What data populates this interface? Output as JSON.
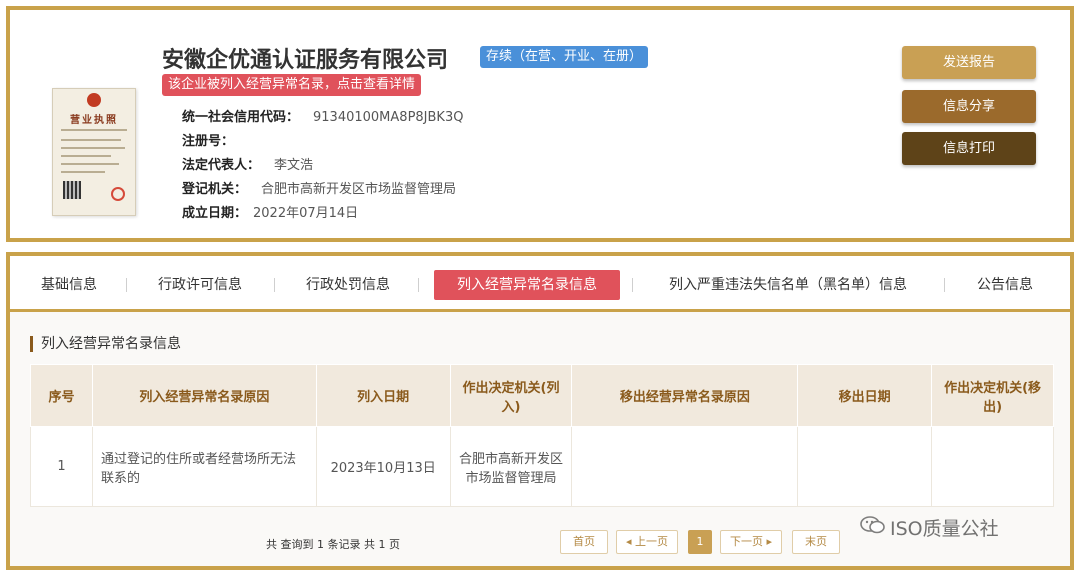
{
  "company": {
    "name": "安徽企优通认证服务有限公司",
    "status": "存续（在营、开业、在册）",
    "alert": "该企业被列入经营异常名录，点击查看详情",
    "license_title": "营业执照",
    "fields": [
      {
        "label": "统一社会信用代码：",
        "value": "91340100MA8P8JBK3Q"
      },
      {
        "label": "注册号：",
        "value": ""
      },
      {
        "label": "法定代表人：",
        "value": "李文浩"
      },
      {
        "label": "登记机关：",
        "value": "合肥市高新开发区市场监督管理局"
      },
      {
        "label": "成立日期：",
        "value": "2022年07月14日"
      }
    ]
  },
  "actions": {
    "send": "发送报告",
    "share": "信息分享",
    "print": "信息打印"
  },
  "tabs": [
    "基础信息",
    "行政许可信息",
    "行政处罚信息",
    "列入经营异常名录信息",
    "列入严重违法失信名单（黑名单）信息",
    "公告信息"
  ],
  "active_tab_index": 3,
  "section": {
    "title": "列入经营异常名录信息",
    "headers": [
      "序号",
      "列入经营异常名录原因",
      "列入日期",
      "作出决定机关(列入)",
      "移出经营异常名录原因",
      "移出日期",
      "作出决定机关(移出)"
    ],
    "rows": [
      [
        "1",
        "通过登记的住所或者经营场所无法联系的",
        "2023年10月13日",
        "合肥市高新开发区市场监督管理局",
        "",
        "",
        ""
      ]
    ]
  },
  "pager": {
    "info": "共 查询到 1 条记录 共 1 页",
    "first": "首页",
    "prev": "◂ 上一页",
    "current": "1",
    "next": "下一页 ▸",
    "last": "末页"
  },
  "watermark": "ISO质量公社",
  "colors": {
    "gold_border": "#c9a24a",
    "status_blue": "#4a90d9",
    "alert_red": "#e0525b",
    "btn_send": "#c9a054",
    "btn_share": "#9b6a2c",
    "btn_print": "#5e4318",
    "header_bg": "#f1e9dd",
    "header_text": "#8a5a1c"
  }
}
